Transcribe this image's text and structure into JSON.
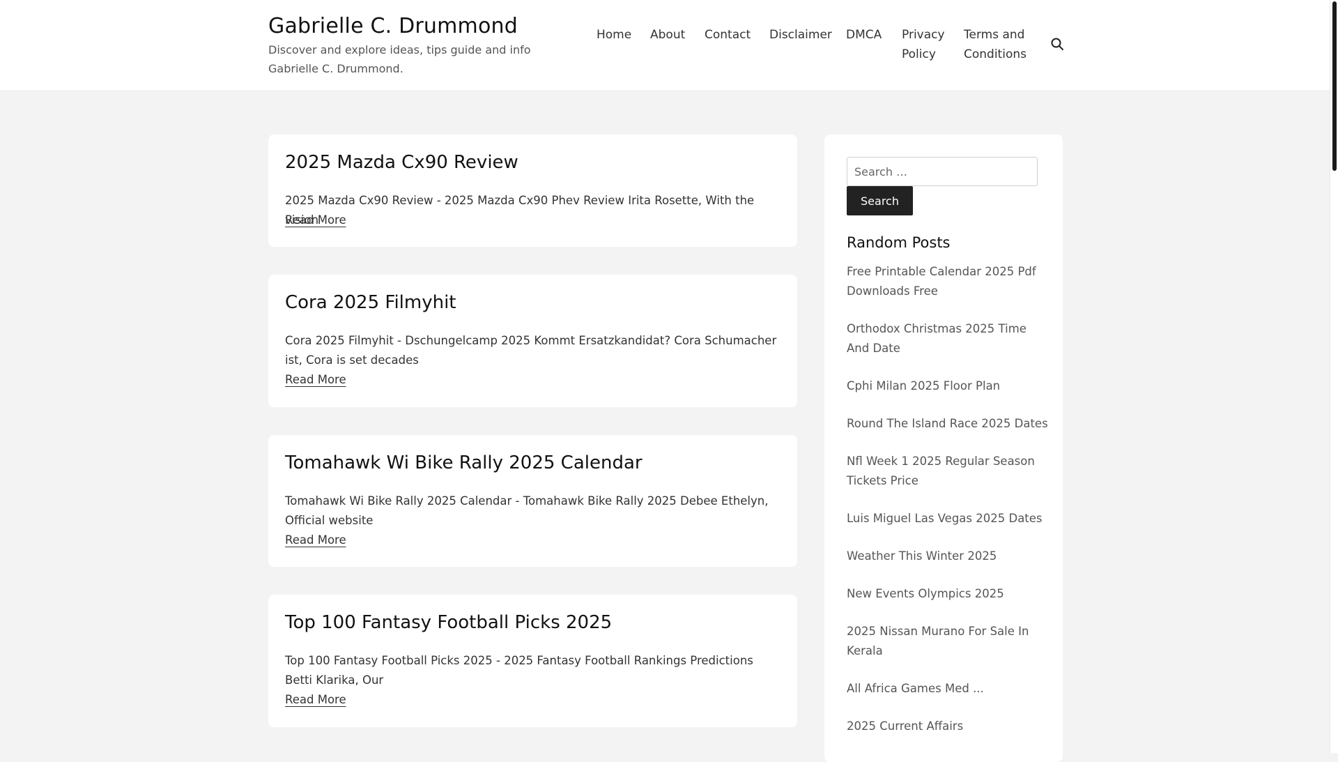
{
  "header": {
    "site_title": "Gabrielle C. Drummond",
    "site_description": "Discover and explore ideas, tips guide and info Gabrielle C. Drummond.",
    "nav": [
      {
        "label": "Home"
      },
      {
        "label": "About"
      },
      {
        "label": "Contact"
      },
      {
        "label": "Disclaimer"
      },
      {
        "label": "DMCA"
      },
      {
        "label": "Privacy Policy"
      },
      {
        "label": "Terms and Conditions"
      }
    ],
    "search_icon": "search-icon"
  },
  "posts": [
    {
      "title": "2025 Mazda Cx90 Review",
      "excerpt": "2025 Mazda Cx90 Review - 2025 Mazda Cx90 Phev Review Irita Rosette, With the vision",
      "read_more": "Read More"
    },
    {
      "title": "Cora 2025 Filmyhit",
      "excerpt": "Cora 2025 Filmyhit - Dschungelcamp 2025 Kommt Ersatzkandidat? Cora Schumacher ist, Cora is set decades",
      "read_more": "Read More"
    },
    {
      "title": "Tomahawk Wi Bike Rally 2025 Calendar",
      "excerpt": "Tomahawk Wi Bike Rally 2025 Calendar - Tomahawk Bike Rally 2025 Debee Ethelyn, Official website",
      "read_more": "Read More"
    },
    {
      "title": "Top 100 Fantasy Football Picks 2025",
      "excerpt": "Top 100 Fantasy Football Picks 2025 - 2025 Fantasy Football Rankings Predictions Betti Klarika, Our",
      "read_more": "Read More"
    }
  ],
  "sidebar": {
    "search_placeholder": "Search …",
    "search_button": "Search",
    "random_posts_title": "Random Posts",
    "random_posts": [
      "Free Printable Calendar 2025 Pdf Downloads Free",
      "Orthodox Christmas 2025 Time And Date",
      "Cphi Milan 2025 Floor Plan",
      "Round The Island Race 2025 Dates",
      "Nfl Week 1 2025 Regular Season Tickets Price",
      "Luis Miguel Las Vegas 2025 Dates",
      "Weather This Winter 2025",
      "New Events Olympics 2025",
      "2025 Nissan Murano For Sale In Kerala",
      "All Africa Games Med ...",
      "2025 Current Affairs"
    ]
  }
}
